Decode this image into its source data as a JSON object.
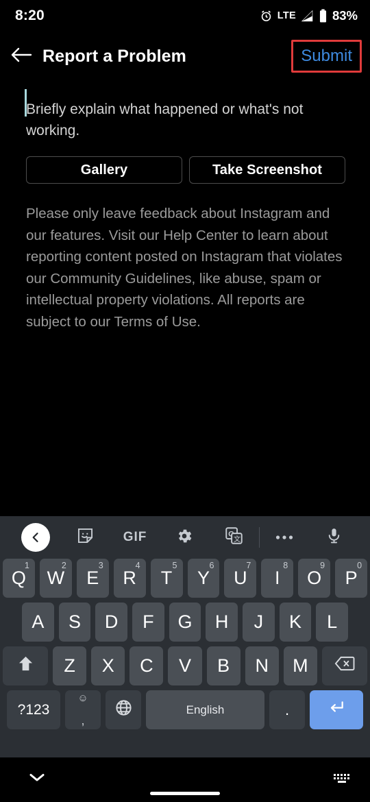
{
  "status_bar": {
    "time": "8:20",
    "network": "LTE",
    "battery_percent": "83%",
    "icons": [
      "alarm-icon",
      "signal-icon",
      "battery-icon"
    ]
  },
  "app_bar": {
    "back_label": "back-arrow",
    "title": "Report a Problem",
    "submit_label": "Submit",
    "submit_color": "#3e8ae0",
    "highlight_color": "#e03b3b"
  },
  "form": {
    "placeholder": "Briefly explain what happened or what's not working.",
    "value": "",
    "caret_color": "#a8d8dd",
    "gallery_label": "Gallery",
    "screenshot_label": "Take Screenshot",
    "disclaimer": "Please only leave feedback about Instagram and our features. Visit our Help Center to learn about reporting content posted on Instagram that violates our Community Guidelines, like abuse, spam or intellectual property violations. All reports are subject to our Terms of Use."
  },
  "keyboard": {
    "toolbar": [
      {
        "name": "expand-toolbar-button",
        "icon": "chevron-left-icon",
        "label": ""
      },
      {
        "name": "sticker-button",
        "icon": "sticker-icon",
        "label": ""
      },
      {
        "name": "gif-button",
        "icon": "gif-icon",
        "label": "GIF"
      },
      {
        "name": "settings-button",
        "icon": "gear-icon",
        "label": ""
      },
      {
        "name": "translate-button",
        "icon": "translate-icon",
        "label": ""
      },
      {
        "name": "more-options-button",
        "icon": "ellipsis-icon",
        "label": ""
      },
      {
        "name": "voice-input-button",
        "icon": "microphone-icon",
        "label": ""
      }
    ],
    "row1": [
      {
        "key": "Q",
        "num": "1"
      },
      {
        "key": "W",
        "num": "2"
      },
      {
        "key": "E",
        "num": "3"
      },
      {
        "key": "R",
        "num": "4"
      },
      {
        "key": "T",
        "num": "5"
      },
      {
        "key": "Y",
        "num": "6"
      },
      {
        "key": "U",
        "num": "7"
      },
      {
        "key": "I",
        "num": "8"
      },
      {
        "key": "O",
        "num": "9"
      },
      {
        "key": "P",
        "num": "0"
      }
    ],
    "row2": [
      "A",
      "S",
      "D",
      "F",
      "G",
      "H",
      "J",
      "K",
      "L"
    ],
    "row3": [
      "Z",
      "X",
      "C",
      "V",
      "B",
      "N",
      "M"
    ],
    "shift_label": "shift-icon",
    "backspace_label": "backspace-icon",
    "symbols_label": "?123",
    "comma_label": ",",
    "comma_emoji_label": "☺",
    "globe_label": "globe-icon",
    "space_label": "English",
    "period_label": ".",
    "enter_label": "enter-icon",
    "enter_color": "#6d9eeb"
  },
  "nav_bar": {
    "dismiss_label": "chevron-down-icon",
    "keyboard_switch_label": "keyboard-switch-icon",
    "home_indicator": "home-indicator"
  }
}
